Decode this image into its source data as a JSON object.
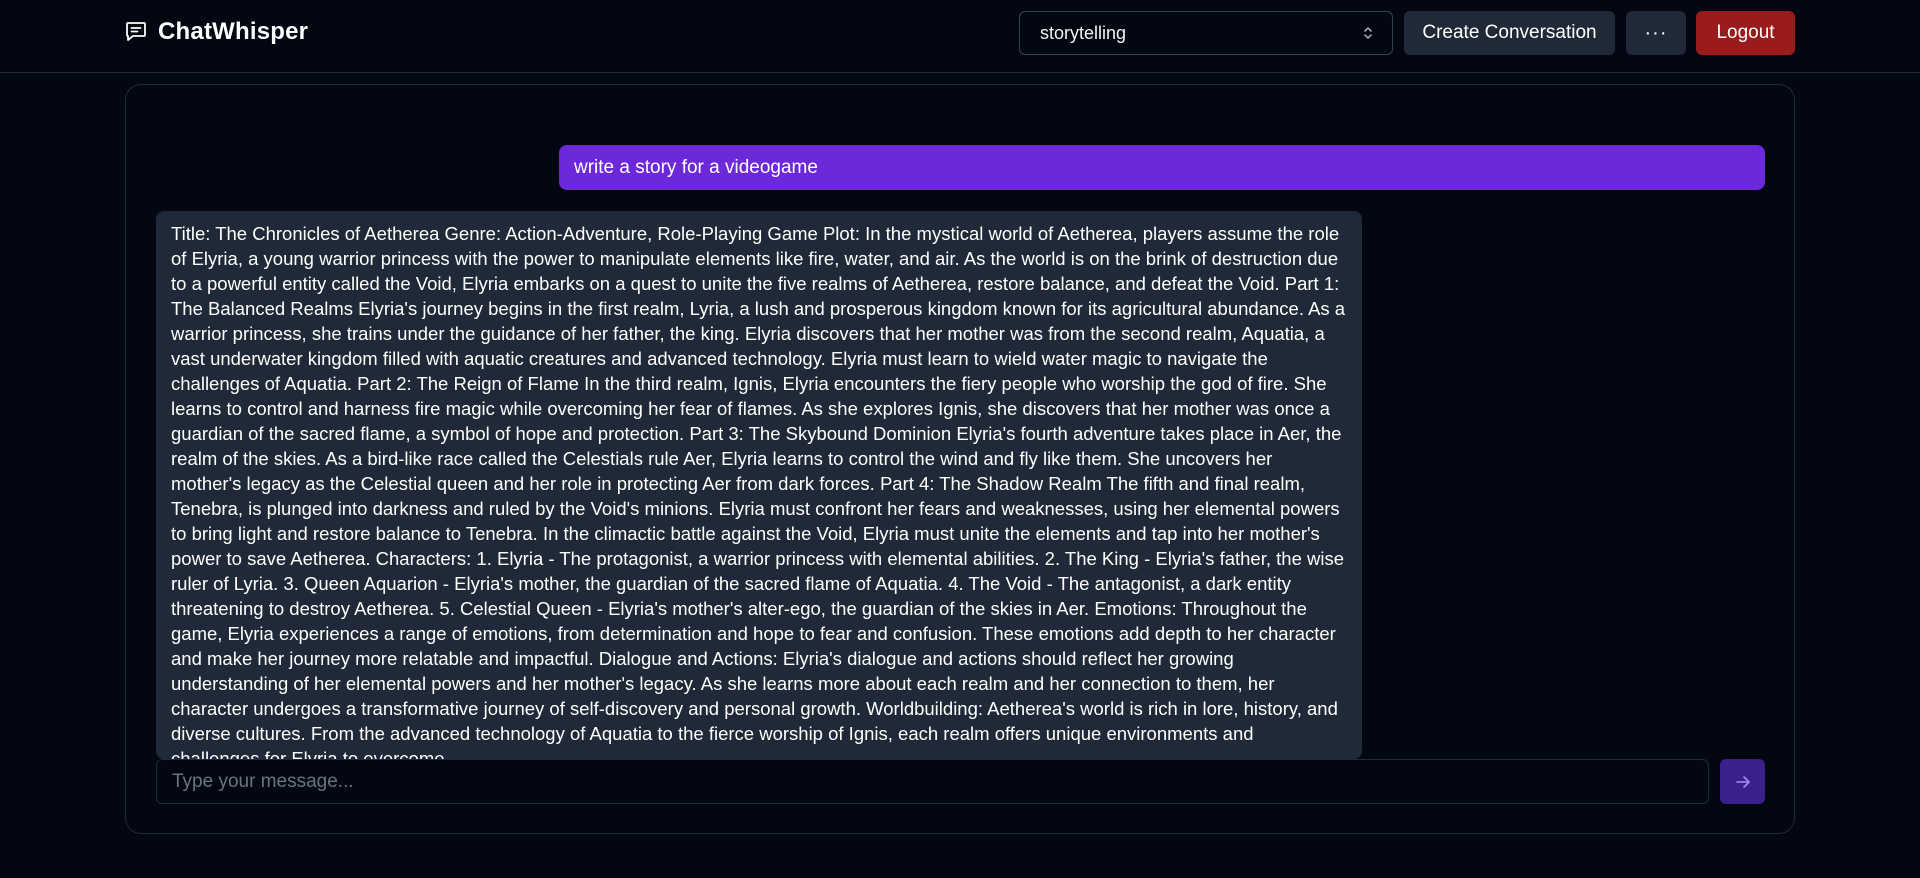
{
  "app": {
    "name": "ChatWhisper",
    "logo_icon": "chat-bubble-icon"
  },
  "header": {
    "mode_select": {
      "value": "storytelling",
      "icon": "chevron-up-down-icon"
    },
    "create_label": "Create Conversation",
    "more_label": "···",
    "logout_label": "Logout"
  },
  "chat": {
    "messages": [
      {
        "role": "user",
        "text": "write a story for a videogame"
      },
      {
        "role": "assistant",
        "text": "Title: The Chronicles of Aetherea Genre: Action-Adventure, Role-Playing Game Plot: In the mystical world of Aetherea, players assume the role of Elyria, a young warrior princess with the power to manipulate elements like fire, water, and air. As the world is on the brink of destruction due to a powerful entity called the Void, Elyria embarks on a quest to unite the five realms of Aetherea, restore balance, and defeat the Void. Part 1: The Balanced Realms Elyria's journey begins in the first realm, Lyria, a lush and prosperous kingdom known for its agricultural abundance. As a warrior princess, she trains under the guidance of her father, the king. Elyria discovers that her mother was from the second realm, Aquatia, a vast underwater kingdom filled with aquatic creatures and advanced technology. Elyria must learn to wield water magic to navigate the challenges of Aquatia. Part 2: The Reign of Flame In the third realm, Ignis, Elyria encounters the fiery people who worship the god of fire. She learns to control and harness fire magic while overcoming her fear of flames. As she explores Ignis, she discovers that her mother was once a guardian of the sacred flame, a symbol of hope and protection. Part 3: The Skybound Dominion Elyria's fourth adventure takes place in Aer, the realm of the skies. As a bird-like race called the Celestials rule Aer, Elyria learns to control the wind and fly like them. She uncovers her mother's legacy as the Celestial queen and her role in protecting Aer from dark forces. Part 4: The Shadow Realm The fifth and final realm, Tenebra, is plunged into darkness and ruled by the Void's minions. Elyria must confront her fears and weaknesses, using her elemental powers to bring light and restore balance to Tenebra. In the climactic battle against the Void, Elyria must unite the elements and tap into her mother's power to save Aetherea. Characters: 1. Elyria - The protagonist, a warrior princess with elemental abilities. 2. The King - Elyria's father, the wise ruler of Lyria. 3. Queen Aquarion - Elyria's mother, the guardian of the sacred flame of Aquatia. 4. The Void - The antagonist, a dark entity threatening to destroy Aetherea. 5. Celestial Queen - Elyria's mother's alter-ego, the guardian of the skies in Aer. Emotions: Throughout the game, Elyria experiences a range of emotions, from determination and hope to fear and confusion. These emotions add depth to her character and make her journey more relatable and impactful. Dialogue and Actions: Elyria's dialogue and actions should reflect her growing understanding of her elemental powers and her mother's legacy. As she learns more about each realm and her connection to them, her character undergoes a transformative journey of self-discovery and personal growth. Worldbuilding: Aetherea's world is rich in lore, history, and diverse cultures. From the advanced technology of Aquatia to the fierce worship of Ignis, each realm offers unique environments and challenges for Elyria to overcome."
      }
    ]
  },
  "composer": {
    "placeholder": "Type your message...",
    "value": "",
    "send_icon": "arrow-right-icon"
  }
}
